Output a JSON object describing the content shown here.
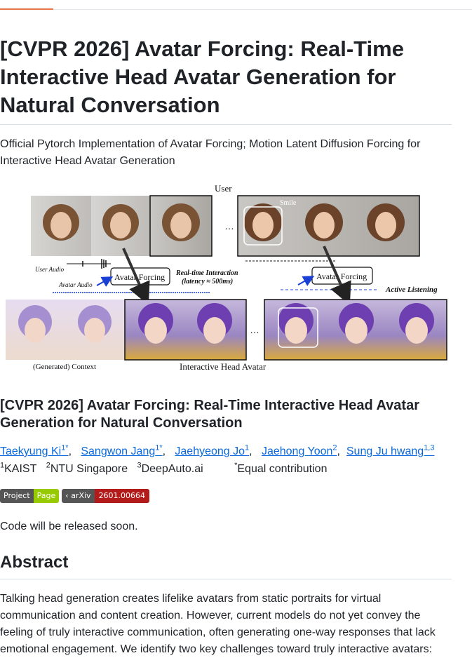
{
  "title": "[CVPR 2026] Avatar Forcing: Real-Time Interactive Head Avatar Generation for Natural Conversation",
  "description": "Official Pytorch Implementation of Avatar Forcing; Motion Latent Diffusion Forcing for Interactive Head Avatar Generation",
  "figure": {
    "user_label": "User",
    "smile_label": "Smile",
    "user_audio": "User Audio",
    "avatar_audio": "Avatar Audio",
    "avatar_forcing_left": "Avatar Forcing",
    "avatar_forcing_right": "Avatar Forcing",
    "realtime_line1": "Real-time Interaction",
    "realtime_line2": "(latency ≈ 500ms)",
    "active_listening": "Active Listening",
    "generated_context": "(Generated) Context",
    "head_avatar": "Interactive Head Avatar",
    "ellipsis_top": "…",
    "ellipsis_bottom": "…"
  },
  "subtitle": "[CVPR 2026] Avatar Forcing: Real-Time Interactive Head Avatar Generation for Natural Conversation",
  "authors": [
    {
      "name": "Taekyung Ki",
      "sup": "1*"
    },
    {
      "name": "Sangwon Jang",
      "sup": "1*"
    },
    {
      "name": "Jaehyeong Jo",
      "sup": "1"
    },
    {
      "name": "Jaehong Yoon",
      "sup": "2"
    },
    {
      "name": "Sung Ju hwang",
      "sup": "1,3"
    }
  ],
  "affiliations": [
    {
      "sup": "1",
      "name": "KAIST"
    },
    {
      "sup": "2",
      "name": "NTU Singapore"
    },
    {
      "sup": "3",
      "name": "DeepAuto.ai"
    },
    {
      "sup": "*",
      "name": "Equal contribution"
    }
  ],
  "badges": {
    "project_left": "Project",
    "project_right": "Page",
    "arxiv_left": "arXiv",
    "arxiv_right": "2601.00664",
    "project_color": "#97ca00",
    "arxiv_color": "#b31b1b"
  },
  "note": "Code will be released soon.",
  "abstract_heading": "Abstract",
  "abstract": "Talking head generation creates lifelike avatars from static portraits for virtual communication and content creation. However, current models do not yet convey the feeling of truly interactive communication, often generating one-way responses that lack emotional engagement. We identify two key challenges toward truly interactive avatars:",
  "colors": {
    "link": "#0969da",
    "accent_tab": "#e8744a"
  }
}
